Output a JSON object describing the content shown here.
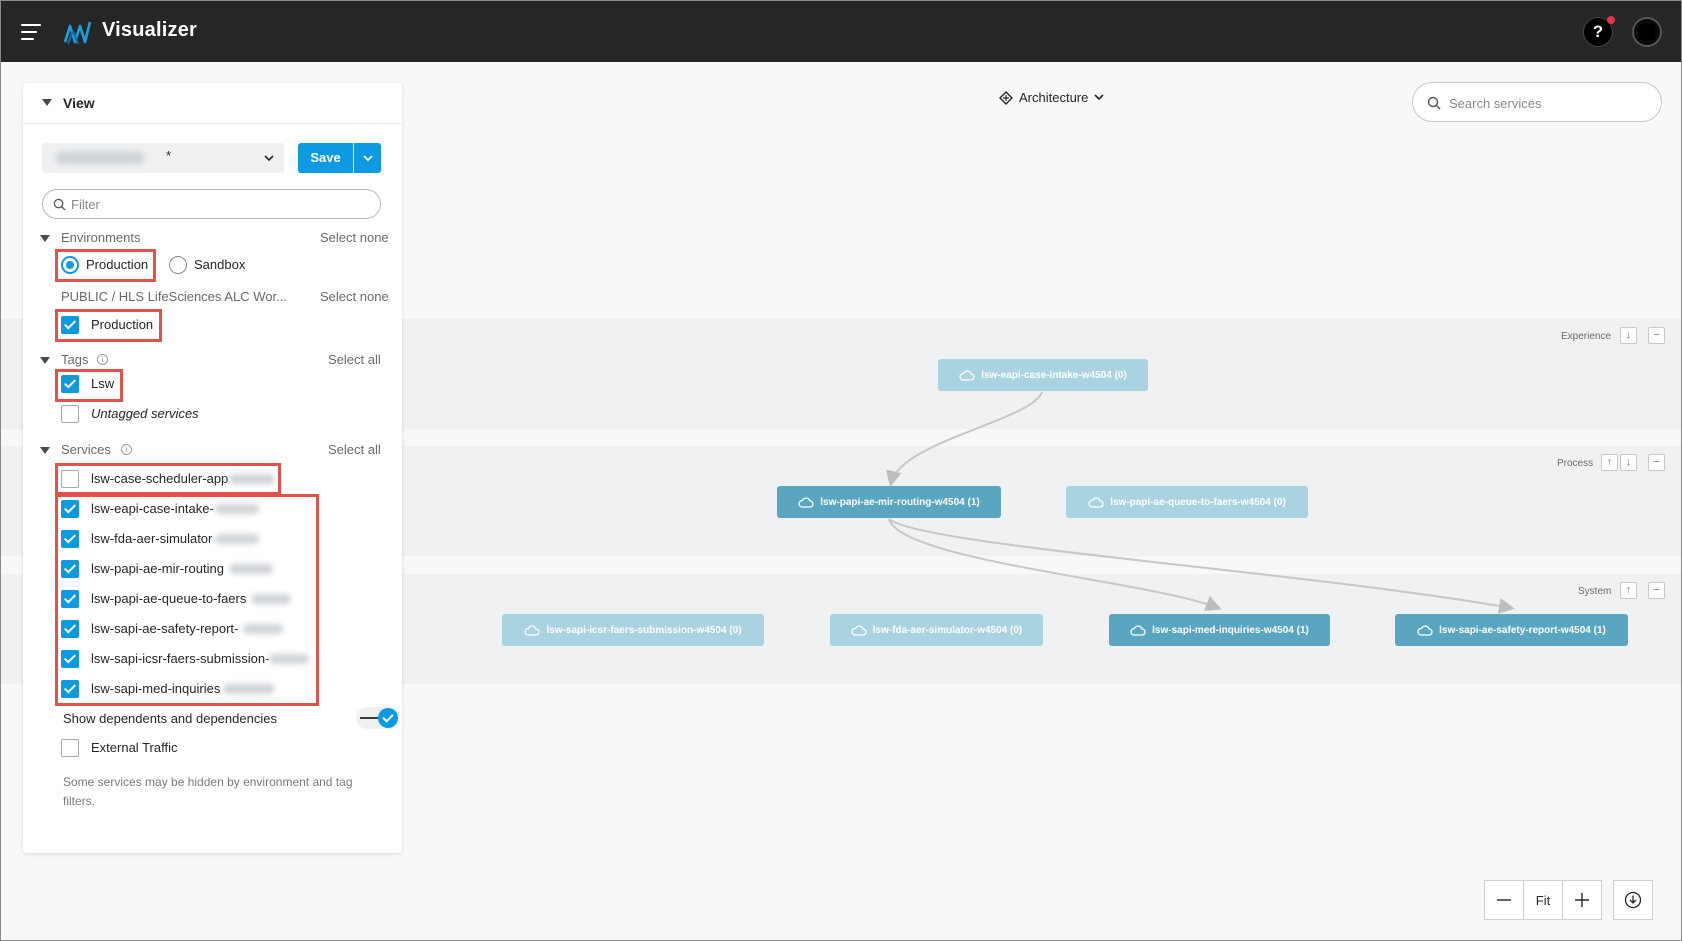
{
  "app": {
    "title": "Visualizer"
  },
  "topbar": {
    "help_label": "?"
  },
  "canvas": {
    "architecture_label": "Architecture",
    "search_placeholder": "Search services",
    "lanes": {
      "experience": "Experience",
      "process": "Process",
      "system": "System"
    },
    "nodes": {
      "eapi_case_intake": "lsw-eapi-case-intake-w4504 (0)",
      "papi_mir_routing": "lsw-papi-ae-mir-routing-w4504 (1)",
      "papi_queue_to_faers": "lsw-papi-ae-queue-to-faers-w4504 (0)",
      "sapi_icsr_faers": "lsw-sapi-icsr-faers-submission-w4504 (0)",
      "sapi_fda_simulator": "lsw-fda-aer-simulator-w4504 (0)",
      "sapi_med_inquiries": "lsw-sapi-med-inquiries-w4504 (1)",
      "sapi_safety_report": "lsw-sapi-ae-safety-report-w4504 (1)"
    },
    "zoom": {
      "fit_label": "Fit"
    }
  },
  "panel": {
    "title": "View",
    "view_select_marker": "*",
    "save_label": "Save",
    "filter_placeholder": "Filter",
    "environments": {
      "title": "Environments",
      "action": "Select none",
      "options": [
        {
          "label": "Production",
          "selected": true
        },
        {
          "label": "Sandbox",
          "selected": false
        }
      ]
    },
    "business_group": {
      "title": "PUBLIC / HLS LifeSciences ALC Wor...",
      "action": "Select none",
      "items": [
        {
          "label": "Production",
          "checked": true
        }
      ]
    },
    "tags": {
      "title": "Tags",
      "action": "Select all",
      "items": [
        {
          "label": "Lsw",
          "checked": true
        },
        {
          "label": "Untagged services",
          "checked": false
        }
      ]
    },
    "services": {
      "title": "Services",
      "action": "Select all",
      "items": [
        {
          "label": "lsw-case-scheduler-app",
          "checked": false
        },
        {
          "label": "lsw-eapi-case-intake-",
          "checked": true
        },
        {
          "label": "lsw-fda-aer-simulator",
          "checked": true
        },
        {
          "label": "lsw-papi-ae-mir-routing",
          "checked": true
        },
        {
          "label": "lsw-papi-ae-queue-to-faers",
          "checked": true
        },
        {
          "label": "lsw-sapi-ae-safety-report-",
          "checked": true
        },
        {
          "label": "lsw-sapi-icsr-faers-submission-",
          "checked": true
        },
        {
          "label": "lsw-sapi-med-inquiries",
          "checked": true
        }
      ]
    },
    "show_dependents": {
      "label": "Show dependents and dependencies",
      "on": true
    },
    "external_traffic": {
      "label": "External Traffic",
      "checked": false
    },
    "note": "Some services may be hidden by environment and tag filters."
  },
  "colors": {
    "topbar": "#262626",
    "accent": "#0e9ae0",
    "node_active": "#5aa6c0",
    "node_faded": "#a9d3e0",
    "highlight": "#e2514a"
  }
}
